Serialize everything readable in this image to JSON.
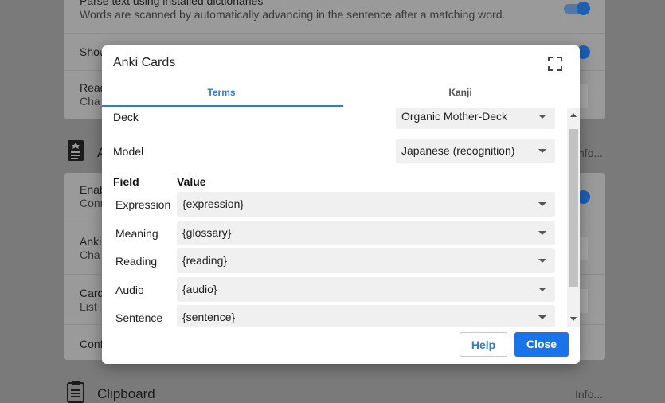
{
  "background": {
    "rows": [
      {
        "title": "Parse text using installed dictionaries",
        "desc": "Words are scanned by automatically advancing in the sentence after a matching word."
      },
      {
        "title": "Show"
      },
      {
        "title": "Read",
        "desc": "Cha"
      },
      {
        "title": "Enab",
        "desc": "Conn"
      },
      {
        "title": "Anki",
        "desc": "Cha"
      },
      {
        "title": "Card",
        "desc": "List"
      },
      {
        "title": "Conf"
      }
    ],
    "anki_section_title": "A",
    "anki_info": "Info...",
    "clipboard_section_title": "Clipboard",
    "clipboard_info": "Info..."
  },
  "modal": {
    "title": "Anki Cards",
    "tabs": [
      {
        "label": "Terms",
        "active": true
      },
      {
        "label": "Kanji",
        "active": false
      }
    ],
    "deck_label": "Deck",
    "deck_value": "Organic Mother-Deck",
    "model_label": "Model",
    "model_value": "Japanese (recognition)",
    "field_header": "Field",
    "value_header": "Value",
    "fields": [
      {
        "name": "Expression",
        "value": "{expression}"
      },
      {
        "name": "Meaning",
        "value": "{glossary}"
      },
      {
        "name": "Reading",
        "value": "{reading}"
      },
      {
        "name": "Audio",
        "value": "{audio}"
      },
      {
        "name": "Sentence",
        "value": "{sentence}"
      }
    ],
    "help_label": "Help",
    "close_label": "Close"
  },
  "colors": {
    "accent": "#1a73e8",
    "tab_active": "#2e7bd4",
    "toggle_knob": "#1e5fb3"
  }
}
